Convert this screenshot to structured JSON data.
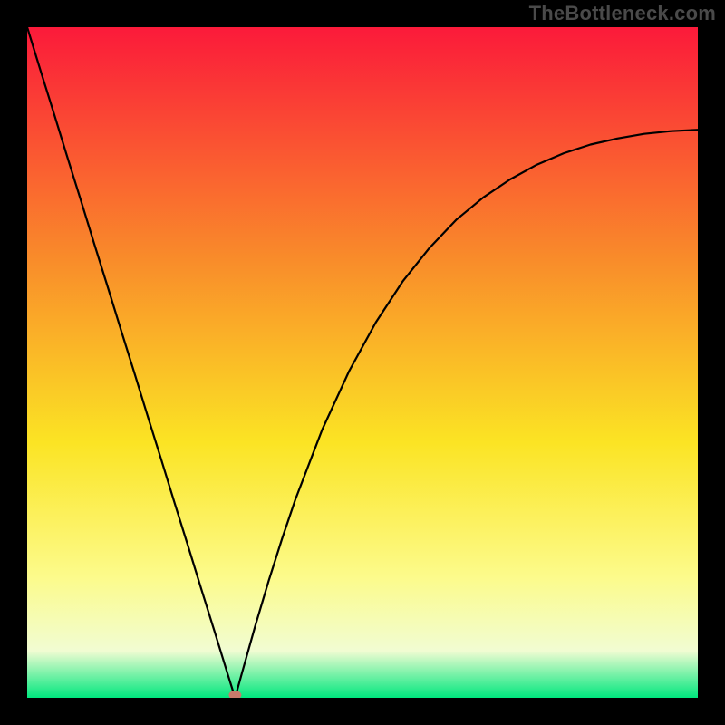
{
  "attribution": "TheBottleneck.com",
  "colors": {
    "frame": "#000000",
    "gradient_top": "#fb1a3a",
    "gradient_mid_upper": "#f98d2a",
    "gradient_mid": "#fbe424",
    "gradient_mid_lower": "#fcfb8b",
    "gradient_lower": "#f1fcd2",
    "gradient_bottom": "#00e77e",
    "curve": "#000000",
    "marker": "#c97a6b"
  },
  "chart_data": {
    "type": "line",
    "title": "",
    "xlabel": "",
    "ylabel": "",
    "xlim": [
      0,
      100
    ],
    "ylim": [
      0,
      100
    ],
    "grid": false,
    "legend": false,
    "x": [
      0,
      2,
      4,
      6,
      8,
      10,
      12,
      14,
      16,
      18,
      20,
      22,
      24,
      26,
      28,
      30,
      31,
      32,
      34,
      36,
      38,
      40,
      44,
      48,
      52,
      56,
      60,
      64,
      68,
      72,
      76,
      80,
      84,
      88,
      92,
      96,
      100
    ],
    "values": [
      100,
      93.5,
      87.1,
      80.6,
      74.2,
      67.7,
      61.3,
      54.8,
      48.4,
      41.9,
      35.5,
      29.0,
      22.6,
      16.1,
      9.7,
      3.2,
      0.0,
      3.6,
      10.7,
      17.4,
      23.7,
      29.6,
      40.0,
      48.7,
      56.0,
      62.1,
      67.1,
      71.3,
      74.6,
      77.3,
      79.5,
      81.2,
      82.5,
      83.4,
      84.1,
      84.5,
      84.7
    ],
    "annotations": [
      {
        "type": "marker",
        "x": 31,
        "y": 0,
        "label": ""
      }
    ]
  }
}
